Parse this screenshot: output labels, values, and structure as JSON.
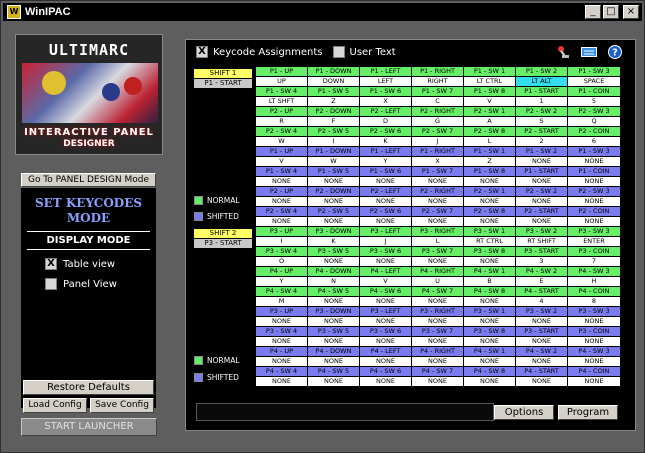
{
  "window": {
    "title": "WinIPAC",
    "app_icon": "W"
  },
  "logo": {
    "brand": "ULTIMARC",
    "line1": "INTERACTIVE PANEL",
    "line2": "DESIGNER"
  },
  "left": {
    "goto_label": "Go To PANEL DESIGN Mode",
    "mode_title": "SET KEYCODES MODE",
    "display_mode": "DISPLAY MODE",
    "table_view": {
      "label": "Table view",
      "checked": "X"
    },
    "panel_view": {
      "label": "Panel View",
      "checked": ""
    },
    "restore": "Restore Defaults",
    "load": "Load Config",
    "save": "Save Config",
    "launcher": "START LAUNCHER"
  },
  "toolbar": {
    "keycode_assign": {
      "label": "Keycode Assignments",
      "checked": "X"
    },
    "user_text": {
      "label": "User Text",
      "checked": ""
    }
  },
  "labels": {
    "shift1": "SHIFT 1",
    "p1start": "P1 - START",
    "shift2": "SHIFT 2",
    "p3start": "P3 - START",
    "normal": "NORMAL",
    "shifted": "SHIFTED"
  },
  "colors": {
    "green": "#66ee66",
    "white": "#ffffff",
    "blue": "#7b7bf0",
    "yellow": "#ffff66",
    "cyan": "#33ddee"
  },
  "grid": [
    [
      [
        "g",
        "P1 - UP"
      ],
      [
        "g",
        "P1 - DOWN"
      ],
      [
        "g",
        "P1 - LEFT"
      ],
      [
        "g",
        "P1 - RIGHT"
      ],
      [
        "g",
        "P1 - SW 1"
      ],
      [
        "g",
        "P1 - SW 2"
      ],
      [
        "g",
        "P1 - SW 3"
      ]
    ],
    [
      [
        "w",
        "UP"
      ],
      [
        "w",
        "DOWN"
      ],
      [
        "w",
        "LEFT"
      ],
      [
        "w",
        "RIGHT"
      ],
      [
        "w",
        "LT CTRL"
      ],
      [
        "c",
        "LT ALT"
      ],
      [
        "w",
        "SPACE"
      ]
    ],
    [
      [
        "g",
        "P1 - SW 4"
      ],
      [
        "g",
        "P1 - SW 5"
      ],
      [
        "g",
        "P1 - SW 6"
      ],
      [
        "g",
        "P1 - SW 7"
      ],
      [
        "g",
        "P1 - SW 8"
      ],
      [
        "g",
        "P1 - START"
      ],
      [
        "g",
        "P1 - COIN"
      ]
    ],
    [
      [
        "w",
        "LT SHFT"
      ],
      [
        "w",
        "Z"
      ],
      [
        "w",
        "X"
      ],
      [
        "w",
        "C"
      ],
      [
        "w",
        "V"
      ],
      [
        "w",
        "1"
      ],
      [
        "w",
        "5"
      ]
    ],
    [
      [
        "g",
        "P2 - UP"
      ],
      [
        "g",
        "P2 - DOWN"
      ],
      [
        "g",
        "P2 - LEFT"
      ],
      [
        "g",
        "P2 - RIGHT"
      ],
      [
        "g",
        "P2 - SW 1"
      ],
      [
        "g",
        "P2 - SW 2"
      ],
      [
        "g",
        "P2 - SW 3"
      ]
    ],
    [
      [
        "w",
        "R"
      ],
      [
        "w",
        "F"
      ],
      [
        "w",
        "D"
      ],
      [
        "w",
        "G"
      ],
      [
        "w",
        "A"
      ],
      [
        "w",
        "S"
      ],
      [
        "w",
        "Q"
      ]
    ],
    [
      [
        "g",
        "P2 - SW 4"
      ],
      [
        "g",
        "P2 - SW 5"
      ],
      [
        "g",
        "P2 - SW 6"
      ],
      [
        "g",
        "P2 - SW 7"
      ],
      [
        "g",
        "P2 - SW 8"
      ],
      [
        "g",
        "P2 - START"
      ],
      [
        "g",
        "P2 - COIN"
      ]
    ],
    [
      [
        "w",
        "W"
      ],
      [
        "w",
        "I"
      ],
      [
        "w",
        "K"
      ],
      [
        "w",
        "J"
      ],
      [
        "w",
        "L"
      ],
      [
        "w",
        "2"
      ],
      [
        "w",
        "6"
      ]
    ],
    [
      [
        "b",
        "P1 - UP"
      ],
      [
        "b",
        "P1 - DOWN"
      ],
      [
        "b",
        "P1 - LEFT"
      ],
      [
        "b",
        "P1 - RIGHT"
      ],
      [
        "b",
        "P1 - SW 1"
      ],
      [
        "b",
        "P1 - SW 2"
      ],
      [
        "b",
        "P1 - SW 3"
      ]
    ],
    [
      [
        "w",
        "V"
      ],
      [
        "w",
        "W"
      ],
      [
        "w",
        "Y"
      ],
      [
        "w",
        "X"
      ],
      [
        "w",
        "Z"
      ],
      [
        "w",
        "NONE"
      ],
      [
        "w",
        "NONE"
      ]
    ],
    [
      [
        "b",
        "P1 - SW 4"
      ],
      [
        "b",
        "P1 - SW 5"
      ],
      [
        "b",
        "P1 - SW 6"
      ],
      [
        "b",
        "P1 - SW 7"
      ],
      [
        "b",
        "P1 - SW 8"
      ],
      [
        "b",
        "P1 - START"
      ],
      [
        "b",
        "P1 - COIN"
      ]
    ],
    [
      [
        "w",
        "NONE"
      ],
      [
        "w",
        "NONE"
      ],
      [
        "w",
        "NONE"
      ],
      [
        "w",
        "NONE"
      ],
      [
        "w",
        "NONE"
      ],
      [
        "w",
        "NONE"
      ],
      [
        "w",
        "NONE"
      ]
    ],
    [
      [
        "b",
        "P2 - UP"
      ],
      [
        "b",
        "P2 - DOWN"
      ],
      [
        "b",
        "P2 - LEFT"
      ],
      [
        "b",
        "P2 - RIGHT"
      ],
      [
        "b",
        "P2 - SW 1"
      ],
      [
        "b",
        "P2 - SW 2"
      ],
      [
        "b",
        "P2 - SW 3"
      ]
    ],
    [
      [
        "w",
        "NONE"
      ],
      [
        "w",
        "NONE"
      ],
      [
        "w",
        "NONE"
      ],
      [
        "w",
        "NONE"
      ],
      [
        "w",
        "NONE"
      ],
      [
        "w",
        "NONE"
      ],
      [
        "w",
        "NONE"
      ]
    ],
    [
      [
        "b",
        "P2 - SW 4"
      ],
      [
        "b",
        "P2 - SW 5"
      ],
      [
        "b",
        "P2 - SW 6"
      ],
      [
        "b",
        "P2 - SW 7"
      ],
      [
        "b",
        "P2 - SW 8"
      ],
      [
        "b",
        "P2 - START"
      ],
      [
        "b",
        "P2 - COIN"
      ]
    ],
    [
      [
        "w",
        "NONE"
      ],
      [
        "w",
        "NONE"
      ],
      [
        "w",
        "NONE"
      ],
      [
        "w",
        "NONE"
      ],
      [
        "w",
        "NONE"
      ],
      [
        "w",
        "NONE"
      ],
      [
        "w",
        "NONE"
      ]
    ],
    [
      [
        "g",
        "P3 - UP"
      ],
      [
        "g",
        "P3 - DOWN"
      ],
      [
        "g",
        "P3 - LEFT"
      ],
      [
        "g",
        "P3 - RIGHT"
      ],
      [
        "g",
        "P3 - SW 1"
      ],
      [
        "g",
        "P3 - SW 2"
      ],
      [
        "g",
        "P3 - SW 3"
      ]
    ],
    [
      [
        "w",
        "I"
      ],
      [
        "w",
        "K"
      ],
      [
        "w",
        "J"
      ],
      [
        "w",
        "L"
      ],
      [
        "w",
        "RT CTRL"
      ],
      [
        "w",
        "RT SHIFT"
      ],
      [
        "w",
        "ENTER"
      ]
    ],
    [
      [
        "g",
        "P3 - SW 4"
      ],
      [
        "g",
        "P3 - SW 5"
      ],
      [
        "g",
        "P3 - SW 6"
      ],
      [
        "g",
        "P3 - SW 7"
      ],
      [
        "g",
        "P3 - SW 8"
      ],
      [
        "g",
        "P3 - START"
      ],
      [
        "g",
        "P3 - COIN"
      ]
    ],
    [
      [
        "w",
        "O"
      ],
      [
        "w",
        "NONE"
      ],
      [
        "w",
        "NONE"
      ],
      [
        "w",
        "NONE"
      ],
      [
        "w",
        "NONE"
      ],
      [
        "w",
        "3"
      ],
      [
        "w",
        "7"
      ]
    ],
    [
      [
        "g",
        "P4 - UP"
      ],
      [
        "g",
        "P4 - DOWN"
      ],
      [
        "g",
        "P4 - LEFT"
      ],
      [
        "g",
        "P4 - RIGHT"
      ],
      [
        "g",
        "P4 - SW 1"
      ],
      [
        "g",
        "P4 - SW 2"
      ],
      [
        "g",
        "P4 - SW 3"
      ]
    ],
    [
      [
        "w",
        "Y"
      ],
      [
        "w",
        "N"
      ],
      [
        "w",
        "V"
      ],
      [
        "w",
        "U"
      ],
      [
        "w",
        "B"
      ],
      [
        "w",
        "E"
      ],
      [
        "w",
        "H"
      ]
    ],
    [
      [
        "g",
        "P4 - SW 4"
      ],
      [
        "g",
        "P4 - SW 5"
      ],
      [
        "g",
        "P4 - SW 6"
      ],
      [
        "g",
        "P4 - SW 7"
      ],
      [
        "g",
        "P4 - SW 8"
      ],
      [
        "g",
        "P4 - START"
      ],
      [
        "g",
        "P4 - COIN"
      ]
    ],
    [
      [
        "w",
        "M"
      ],
      [
        "w",
        "NONE"
      ],
      [
        "w",
        "NONE"
      ],
      [
        "w",
        "NONE"
      ],
      [
        "w",
        "NONE"
      ],
      [
        "w",
        "4"
      ],
      [
        "w",
        "8"
      ]
    ],
    [
      [
        "b",
        "P3 - UP"
      ],
      [
        "b",
        "P3 - DOWN"
      ],
      [
        "b",
        "P3 - LEFT"
      ],
      [
        "b",
        "P3 - RIGHT"
      ],
      [
        "b",
        "P3 - SW 1"
      ],
      [
        "b",
        "P3 - SW 2"
      ],
      [
        "b",
        "P3 - SW 3"
      ]
    ],
    [
      [
        "w",
        "NONE"
      ],
      [
        "w",
        "NONE"
      ],
      [
        "w",
        "NONE"
      ],
      [
        "w",
        "NONE"
      ],
      [
        "w",
        "NONE"
      ],
      [
        "w",
        "NONE"
      ],
      [
        "w",
        "NONE"
      ]
    ],
    [
      [
        "b",
        "P3 - SW 4"
      ],
      [
        "b",
        "P3 - SW 5"
      ],
      [
        "b",
        "P3 - SW 6"
      ],
      [
        "b",
        "P3 - SW 7"
      ],
      [
        "b",
        "P3 - SW 8"
      ],
      [
        "b",
        "P3 - START"
      ],
      [
        "b",
        "P3 - COIN"
      ]
    ],
    [
      [
        "w",
        "NONE"
      ],
      [
        "w",
        "NONE"
      ],
      [
        "w",
        "NONE"
      ],
      [
        "w",
        "NONE"
      ],
      [
        "w",
        "NONE"
      ],
      [
        "w",
        "NONE"
      ],
      [
        "w",
        "NONE"
      ]
    ],
    [
      [
        "b",
        "P4 - UP"
      ],
      [
        "b",
        "P4 - DOWN"
      ],
      [
        "b",
        "P4 - LEFT"
      ],
      [
        "b",
        "P4 - RIGHT"
      ],
      [
        "b",
        "P4 - SW 1"
      ],
      [
        "b",
        "P4 - SW 2"
      ],
      [
        "b",
        "P4 - SW 3"
      ]
    ],
    [
      [
        "w",
        "NONE"
      ],
      [
        "w",
        "NONE"
      ],
      [
        "w",
        "NONE"
      ],
      [
        "w",
        "NONE"
      ],
      [
        "w",
        "NONE"
      ],
      [
        "w",
        "NONE"
      ],
      [
        "w",
        "NONE"
      ]
    ],
    [
      [
        "b",
        "P4 - SW 4"
      ],
      [
        "b",
        "P4 - SW 5"
      ],
      [
        "b",
        "P4 - SW 6"
      ],
      [
        "b",
        "P4 - SW 7"
      ],
      [
        "b",
        "P4 - SW 8"
      ],
      [
        "b",
        "P4 - START"
      ],
      [
        "b",
        "P4 - COIN"
      ]
    ],
    [
      [
        "w",
        "NONE"
      ],
      [
        "w",
        "NONE"
      ],
      [
        "w",
        "NONE"
      ],
      [
        "w",
        "NONE"
      ],
      [
        "w",
        "NONE"
      ],
      [
        "w",
        "NONE"
      ],
      [
        "w",
        "NONE"
      ]
    ]
  ],
  "bottom": {
    "options": "Options",
    "program": "Program",
    "status_text": ""
  }
}
